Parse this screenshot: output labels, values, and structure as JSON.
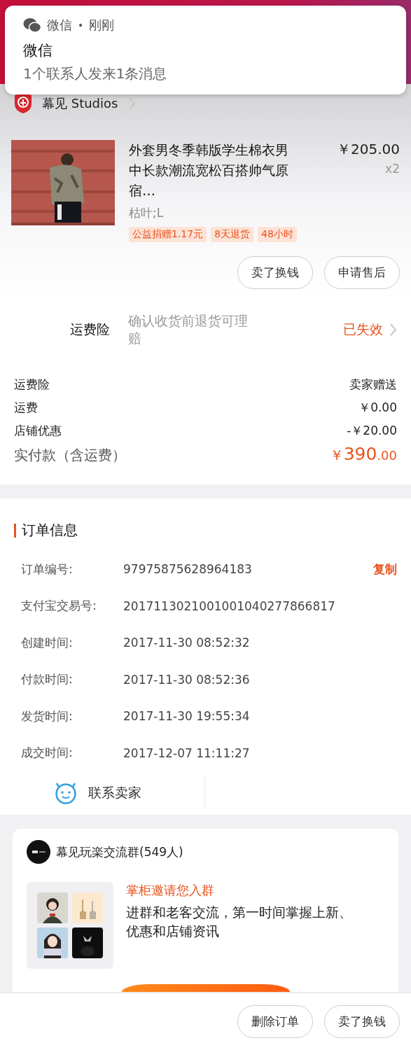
{
  "notification": {
    "app": "微信",
    "separator": "•",
    "time": "刚刚",
    "title": "微信",
    "message": "1个联系人发来1条消息"
  },
  "shop": {
    "name": "幕见 Studios"
  },
  "product": {
    "title": "外套男冬季韩版学生棉衣男中长款潮流宽松百搭帅气原宿…",
    "price": "￥205.00",
    "quantity": "x2",
    "sku": "枯叶;L",
    "tags": [
      "公益捐赠1.17元",
      "8天退货",
      "48小时"
    ]
  },
  "item_actions": [
    "卖了换钱",
    "申请售后"
  ],
  "insurance": {
    "label": "运费险",
    "description": "确认收货前退货可理赔",
    "status": "已失效"
  },
  "fees": [
    {
      "label": "运费险",
      "value": "卖家赠送"
    },
    {
      "label": "运费",
      "value": "￥0.00"
    },
    {
      "label": "店铺优惠",
      "value": "-￥20.00"
    }
  ],
  "total": {
    "label": "实付款（含运费）",
    "currency": "￥",
    "integer": "390",
    "decimal": ".00"
  },
  "order_info": {
    "title": "订单信息",
    "rows": [
      {
        "label": "订单编号:",
        "value": "97975875628964183",
        "action": "复制"
      },
      {
        "label": "支付宝交易号:",
        "value": "2017113021001001040277866817"
      },
      {
        "label": "创建时间:",
        "value": "2017-11-30 08:52:32"
      },
      {
        "label": "付款时间:",
        "value": "2017-11-30 08:52:36"
      },
      {
        "label": "发货时间:",
        "value": "2017-11-30 19:55:34"
      },
      {
        "label": "成交时间:",
        "value": "2017-12-07 11:11:27"
      }
    ]
  },
  "contact": {
    "label": "联系卖家"
  },
  "group": {
    "name": "幕见玩楽交流群(549人)",
    "invite_title": "掌柜邀请您入群",
    "invite_text": "进群和老客交流，第一时间掌握上新、优惠和店铺资讯"
  },
  "bottom_actions": [
    "删除订单",
    "卖了换钱"
  ]
}
